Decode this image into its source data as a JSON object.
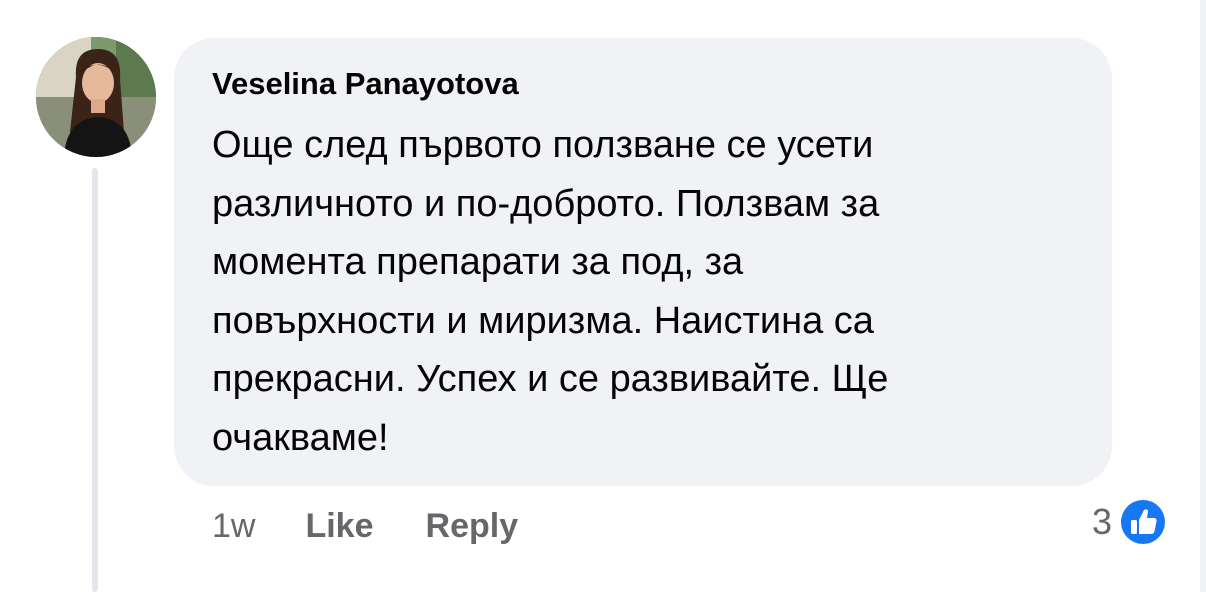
{
  "comment": {
    "author": "Veselina Panayotova",
    "text": "Още след първото ползване се усети\nразличното и по-доброто. Ползвам за\nмомента препарати за под, за\nповърхности и миризма.  Наистина са\nпрекрасни. Успех и се развивайте. Ще\nочакваме!",
    "timestamp": "1w",
    "like_label": "Like",
    "reply_label": "Reply",
    "reaction_count": "3",
    "reaction_icon": "thumbs-up-icon",
    "reaction_color": "#1877f2"
  },
  "colors": {
    "bubble": "#f0f2f5",
    "text": "#050505",
    "secondary": "#65676b",
    "thread_line": "#e4e6eb"
  }
}
